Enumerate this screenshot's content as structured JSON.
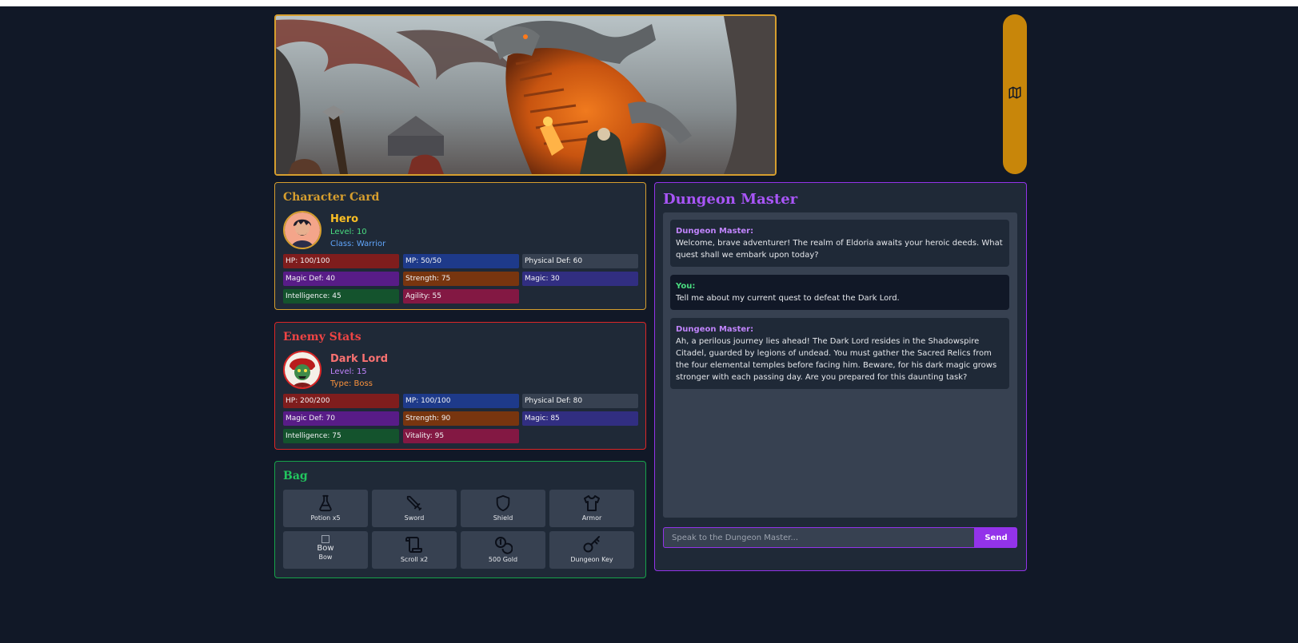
{
  "character": {
    "title": "Character Card",
    "name": "Hero",
    "level": "Level: 10",
    "class": "Class: Warrior",
    "stats": [
      {
        "label": "HP: 100/100",
        "color": "#7f1d1d"
      },
      {
        "label": "MP: 50/50",
        "color": "#1e3a8a"
      },
      {
        "label": "Physical Def: 60",
        "color": "#374151"
      },
      {
        "label": "Magic Def: 40",
        "color": "#581c87"
      },
      {
        "label": "Strength: 75",
        "color": "#78350f"
      },
      {
        "label": "Magic: 30",
        "color": "#312e81"
      },
      {
        "label": "Intelligence: 45",
        "color": "#14532d"
      },
      {
        "label": "Agility: 55",
        "color": "#831843"
      }
    ]
  },
  "enemy": {
    "title": "Enemy Stats",
    "name": "Dark Lord",
    "level": "Level: 15",
    "type": "Type: Boss",
    "stats": [
      {
        "label": "HP: 200/200",
        "color": "#7f1d1d"
      },
      {
        "label": "MP: 100/100",
        "color": "#1e3a8a"
      },
      {
        "label": "Physical Def: 80",
        "color": "#374151"
      },
      {
        "label": "Magic Def: 70",
        "color": "#581c87"
      },
      {
        "label": "Strength: 90",
        "color": "#78350f"
      },
      {
        "label": "Magic: 85",
        "color": "#312e81"
      },
      {
        "label": "Intelligence: 75",
        "color": "#14532d"
      },
      {
        "label": "Vitality: 95",
        "color": "#831843"
      }
    ]
  },
  "bag": {
    "title": "Bag",
    "items": [
      {
        "label": "Potion x5",
        "icon": "potion-icon"
      },
      {
        "label": "Sword",
        "icon": "sword-icon"
      },
      {
        "label": "Shield",
        "icon": "shield-icon"
      },
      {
        "label": "Armor",
        "icon": "armor-icon"
      },
      {
        "label": "Bow",
        "icon": "broken-image",
        "alt": "Bow"
      },
      {
        "label": "Scroll x2",
        "icon": "scroll-icon"
      },
      {
        "label": "500 Gold",
        "icon": "coins-icon"
      },
      {
        "label": "Dungeon Key",
        "icon": "key-icon"
      }
    ]
  },
  "dungeon_master": {
    "title": "Dungeon Master",
    "messages": [
      {
        "speaker": "Dungeon Master:",
        "text": "Welcome, brave adventurer! The realm of Eldoria awaits your heroic deeds. What quest shall we embark upon today?"
      },
      {
        "speaker": "You:",
        "text": "Tell me about my current quest to defeat the Dark Lord."
      },
      {
        "speaker": "Dungeon Master:",
        "text": "Ah, a perilous journey lies ahead! The Dark Lord resides in the Shadowspire Citadel, guarded by legions of undead. You must gather the Sacred Relics from the four elemental temples before facing him. Beware, for his dark magic grows stronger with each passing day. Are you prepared for this daunting task?"
      }
    ],
    "input_placeholder": "Speak to the Dungeon Master...",
    "send_label": "Send"
  },
  "map_tab": {
    "icon": "map-icon"
  },
  "colors": {
    "gold": "#d69e2e",
    "red": "#dc2626",
    "green": "#16a34a",
    "purple": "#9333ea",
    "background": "#111827"
  }
}
